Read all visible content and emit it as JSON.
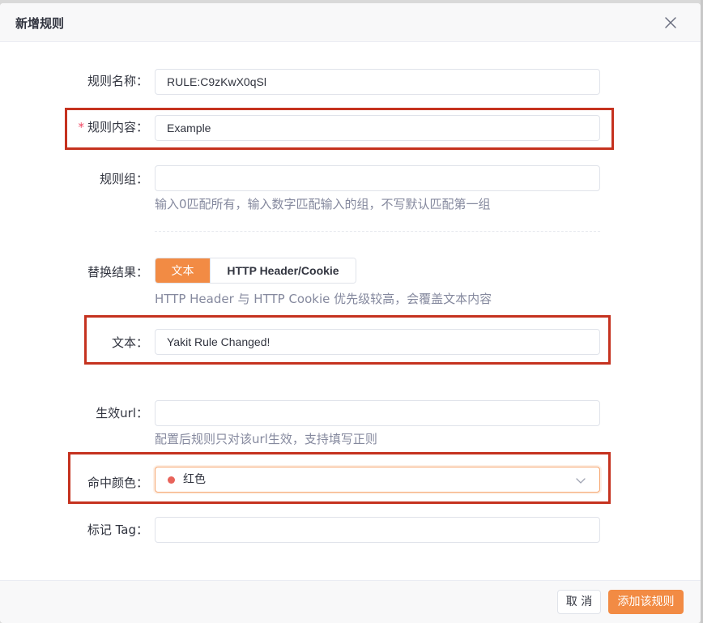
{
  "modal": {
    "title": "新增规则",
    "close_icon": "close-icon"
  },
  "form": {
    "rule_name": {
      "label": "规则名称",
      "value": "RULE:C9zKwX0qSl"
    },
    "rule_content": {
      "required_mark": "*",
      "label": "规则内容",
      "value": "Example",
      "addon_icon": "sliders-icon"
    },
    "rule_group": {
      "label": "规则组",
      "value": "",
      "help": "输入0匹配所有，输入数字匹配输入的组，不写默认匹配第一组"
    },
    "replace_result": {
      "label": "替换结果",
      "options": [
        "文本",
        "HTTP Header/Cookie"
      ],
      "selected": "文本",
      "help": "HTTP Header 与 HTTP Cookie 优先级较高，会覆盖文本内容"
    },
    "text": {
      "label": "文本",
      "value": "Yakit Rule Changed!"
    },
    "effective_url": {
      "label": "生效url",
      "value": "",
      "help": "配置后规则只对该url生效，支持填写正则"
    },
    "hit_color": {
      "label": "命中颜色",
      "selected": "红色",
      "dot_color": "#e8635a",
      "chevron_icon": "chevron-down-icon"
    },
    "tag": {
      "label": "标记 Tag",
      "value": ""
    }
  },
  "footer": {
    "cancel_label": "取 消",
    "submit_label": "添加该规则"
  },
  "colors": {
    "accent": "#f28b44",
    "highlight_box": "#c5321f"
  }
}
